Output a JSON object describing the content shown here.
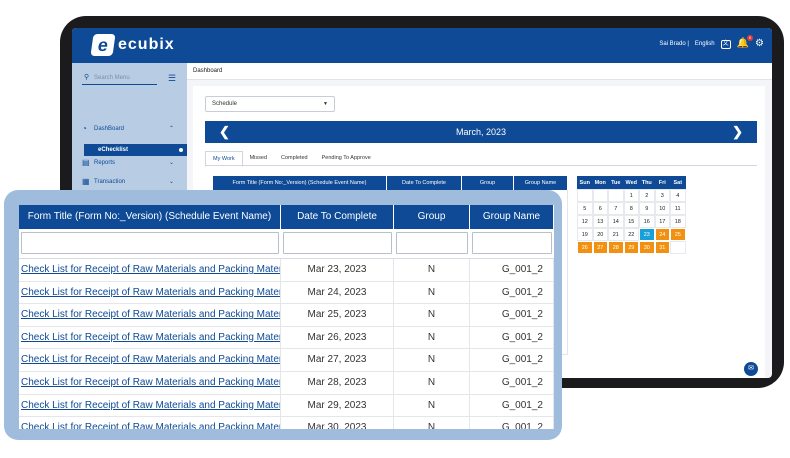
{
  "app": {
    "brand": "ecubix",
    "brand_mark": "e",
    "user": "Sai Brado |",
    "language": "English",
    "notification_count": "6",
    "accent_color": "#0e4a96",
    "highlight_color": "#f29111",
    "today_color": "#1aa0d8"
  },
  "sidebar": {
    "search_placeholder": "Search Menu",
    "items": [
      {
        "label": "DashBoard",
        "icon": "gauge-icon"
      },
      {
        "label": "eChecklist",
        "active": true
      },
      {
        "label": "Reports",
        "icon": "report-icon"
      },
      {
        "label": "Transaction",
        "icon": "transaction-icon"
      }
    ]
  },
  "breadcrumb": "Dashboard",
  "schedule_select": "Schedule",
  "calendar_title": "March, 2023",
  "tabs": [
    "My Work",
    "Missed",
    "Completed",
    "Pending To Approve"
  ],
  "table": {
    "columns": [
      "Form Title (Form No:_Version) (Schedule Event Name)",
      "Date To Complete",
      "Group",
      "Group Name"
    ],
    "rows": [
      {
        "title": "Check List for Receipt of Raw Materials and Packing Materials",
        "date": "Mar 23, 2023",
        "group": "N",
        "group_name": "G_001_2"
      },
      {
        "title": "Check List for Receipt of Raw Materials and Packing Materials",
        "date": "Mar 24, 2023",
        "group": "N",
        "group_name": "G_001_2"
      },
      {
        "title": "Check List for Receipt of Raw Materials and Packing Materials",
        "date": "Mar 25, 2023",
        "group": "N",
        "group_name": "G_001_2"
      },
      {
        "title": "Check List for Receipt of Raw Materials and Packing Materials",
        "date": "Mar 26, 2023",
        "group": "N",
        "group_name": "G_001_2"
      },
      {
        "title": "Check List for Receipt of Raw Materials and Packing Materials",
        "date": "Mar 27, 2023",
        "group": "N",
        "group_name": "G_001_2"
      },
      {
        "title": "Check List for Receipt of Raw Materials and Packing Materials",
        "date": "Mar 28, 2023",
        "group": "N",
        "group_name": "G_001_2"
      },
      {
        "title": "Check List for Receipt of Raw Materials and Packing Materials",
        "date": "Mar 29, 2023",
        "group": "N",
        "group_name": "G_001_2"
      },
      {
        "title": "Check List for Receipt of Raw Materials and Packing Materials",
        "date": "Mar 30, 2023",
        "group": "N",
        "group_name": "G_001_2"
      }
    ]
  },
  "calendar": {
    "weekdays": [
      "Sun",
      "Mon",
      "Tue",
      "Wed",
      "Thu",
      "Fri",
      "Sat"
    ],
    "weeks": [
      [
        "",
        "",
        "",
        "1",
        "2",
        "3",
        "4"
      ],
      [
        "5",
        "6",
        "7",
        "8",
        "9",
        "10",
        "11"
      ],
      [
        "12",
        "13",
        "14",
        "15",
        "16",
        "17",
        "18"
      ],
      [
        "19",
        "20",
        "21",
        "22",
        "23",
        "24",
        "25"
      ],
      [
        "26",
        "27",
        "28",
        "29",
        "30",
        "31",
        ""
      ]
    ],
    "today": "23",
    "highlighted": [
      "24",
      "25",
      "26",
      "27",
      "28",
      "29",
      "30",
      "31"
    ]
  }
}
